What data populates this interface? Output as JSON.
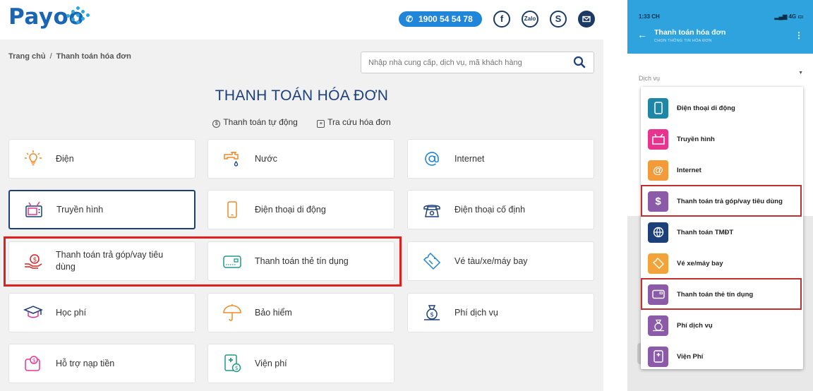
{
  "web": {
    "logo": "Payoo",
    "hotline": "1900 54 54 78",
    "social": {
      "facebook": "f",
      "zalo": "Zalo",
      "skype": "S"
    },
    "breadcrumb": {
      "home": "Trang chủ",
      "separator": "/",
      "current": "Thanh toán hóa đơn"
    },
    "search": {
      "placeholder": "Nhập nhà cung cấp, dịch vụ, mã khách hàng"
    },
    "title": "THANH TOÁN HÓA ĐƠN",
    "links": {
      "auto_pay": "Thanh toán tự động",
      "lookup": "Tra cứu hóa đơn"
    },
    "services": [
      {
        "label": "Điện",
        "icon": "bulb-icon"
      },
      {
        "label": "Nước",
        "icon": "water-tap-icon"
      },
      {
        "label": "Internet",
        "icon": "at-sign-icon"
      },
      {
        "label": "Truyền hình",
        "icon": "tv-icon",
        "active": true
      },
      {
        "label": "Điện thoại di động",
        "icon": "mobile-phone-icon"
      },
      {
        "label": "Điện thoại cố định",
        "icon": "landline-phone-icon"
      },
      {
        "label": "Thanh toán trả góp/vay tiêu dùng",
        "icon": "loan-hand-icon"
      },
      {
        "label": "Thanh toán thẻ tín dụng",
        "icon": "credit-card-icon"
      },
      {
        "label": "Vé tàu/xe/máy bay",
        "icon": "ticket-icon"
      },
      {
        "label": "Học phí",
        "icon": "graduation-cap-icon"
      },
      {
        "label": "Bảo hiểm",
        "icon": "umbrella-icon"
      },
      {
        "label": "Phí dịch vụ",
        "icon": "money-bag-icon"
      },
      {
        "label": "Hỗ trợ nạp tiền",
        "icon": "wallet-icon"
      },
      {
        "label": "Viện phí",
        "icon": "medical-bill-icon"
      }
    ],
    "colors": {
      "navy": "#1d3f7a",
      "orange": "#f08a24",
      "highlight_red": "#e0201f",
      "hotline_blue": "#1f86d9"
    }
  },
  "phone": {
    "status": {
      "time": "1:33 CH",
      "network": "4G"
    },
    "header": {
      "title": "Thanh toán hóa đơn",
      "subtitle": "CHỌN THÔNG TIN HÓA ĐƠN"
    },
    "field_label": "Dịch vụ",
    "options": [
      {
        "label": "Điện thoại di động",
        "icon": "mobile-phone-icon",
        "color": "#1f86a6"
      },
      {
        "label": "Truyền hình",
        "icon": "tv-icon",
        "color": "#e8348f"
      },
      {
        "label": "Internet",
        "icon": "at-sign-icon",
        "color": "#f39a3a"
      },
      {
        "label": "Thanh toán trả góp/vay tiêu dùng",
        "icon": "loan-hand-icon",
        "color": "#8b5aa8"
      },
      {
        "label": "Thanh toán TMĐT",
        "icon": "globe-cart-icon",
        "color": "#1d3f7a"
      },
      {
        "label": "Vé xe/máy bay",
        "icon": "ticket-icon",
        "color": "#f2a33a"
      },
      {
        "label": "Thanh toán thẻ tín dụng",
        "icon": "credit-card-icon",
        "color": "#8b5aa8"
      },
      {
        "label": "Phí dịch vụ",
        "icon": "money-bag-icon",
        "color": "#8b5aa8"
      },
      {
        "label": "Viện Phí",
        "icon": "medical-bill-icon",
        "color": "#8b5aa8"
      }
    ]
  }
}
